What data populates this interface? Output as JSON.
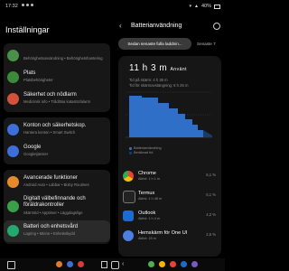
{
  "status": {
    "time": "17:32",
    "battery": "40%"
  },
  "left": {
    "title": "Inställningar",
    "groups": [
      [
        {
          "t": "",
          "s": "Behörighetsanvändning • Behörighetshantering",
          "color": "#4a8f4a"
        },
        {
          "t": "Plats",
          "s": "Platsbehörigheter",
          "color": "#3d8a3d"
        },
        {
          "t": "Säkerhet och nödlarm",
          "s": "Medicinsk info • Trådlösa katastrofalarm",
          "color": "#d2523c"
        }
      ],
      [
        {
          "t": "Konton och säkerhetskop.",
          "s": "Hantera konton • Smart Switch",
          "color": "#3e6fd8"
        },
        {
          "t": "Google",
          "s": "Googletjänster",
          "color": "#3e6fd8"
        }
      ],
      [
        {
          "t": "Avancerade funktioner",
          "s": "Android Auto • Labbar • Bixby Routines",
          "color": "#e78a2c"
        },
        {
          "t": "Digitalt välbefinnande och föräldrakontroller",
          "s": "Skärmtid • Apptimer • Läggdagslige",
          "color": "#3b9e4a"
        },
        {
          "t": "Batteri och enhetsvård",
          "s": "Lagring • Minne • Enhetsskydd",
          "color": "#23a86d"
        }
      ]
    ]
  },
  "right": {
    "title": "Batterianvändning",
    "tab_active": "Sedan senaste fulla laddnin...",
    "tab_other": "Senaste 7",
    "total": "11 h 3 m",
    "total_suffix": "Använt",
    "line1": "Tid på skärm: 4 h 36 m",
    "line2": "Tid för skärmavstängning: 6 h 25 m",
    "legend1": "Batterianvändning",
    "legend2": "Beräknad tid",
    "apps": [
      {
        "name": "Chrome",
        "sub": "Aktivt: 1 h 1 m",
        "pct": "6,1 %",
        "color": "#e8e8e8"
      },
      {
        "name": "Termux",
        "sub": "Aktivt: 1 h 48 m",
        "pct": "5,1 %",
        "color": "#222222"
      },
      {
        "name": "Outlook",
        "sub": "Aktivt: 1 h 4 m",
        "pct": "4,2 %",
        "color": "#1d6bd1"
      },
      {
        "name": "Hemskärm för One UI",
        "sub": "Aktivt: 15 m",
        "pct": "2,5 %",
        "color": "#4c7fe0"
      }
    ]
  }
}
